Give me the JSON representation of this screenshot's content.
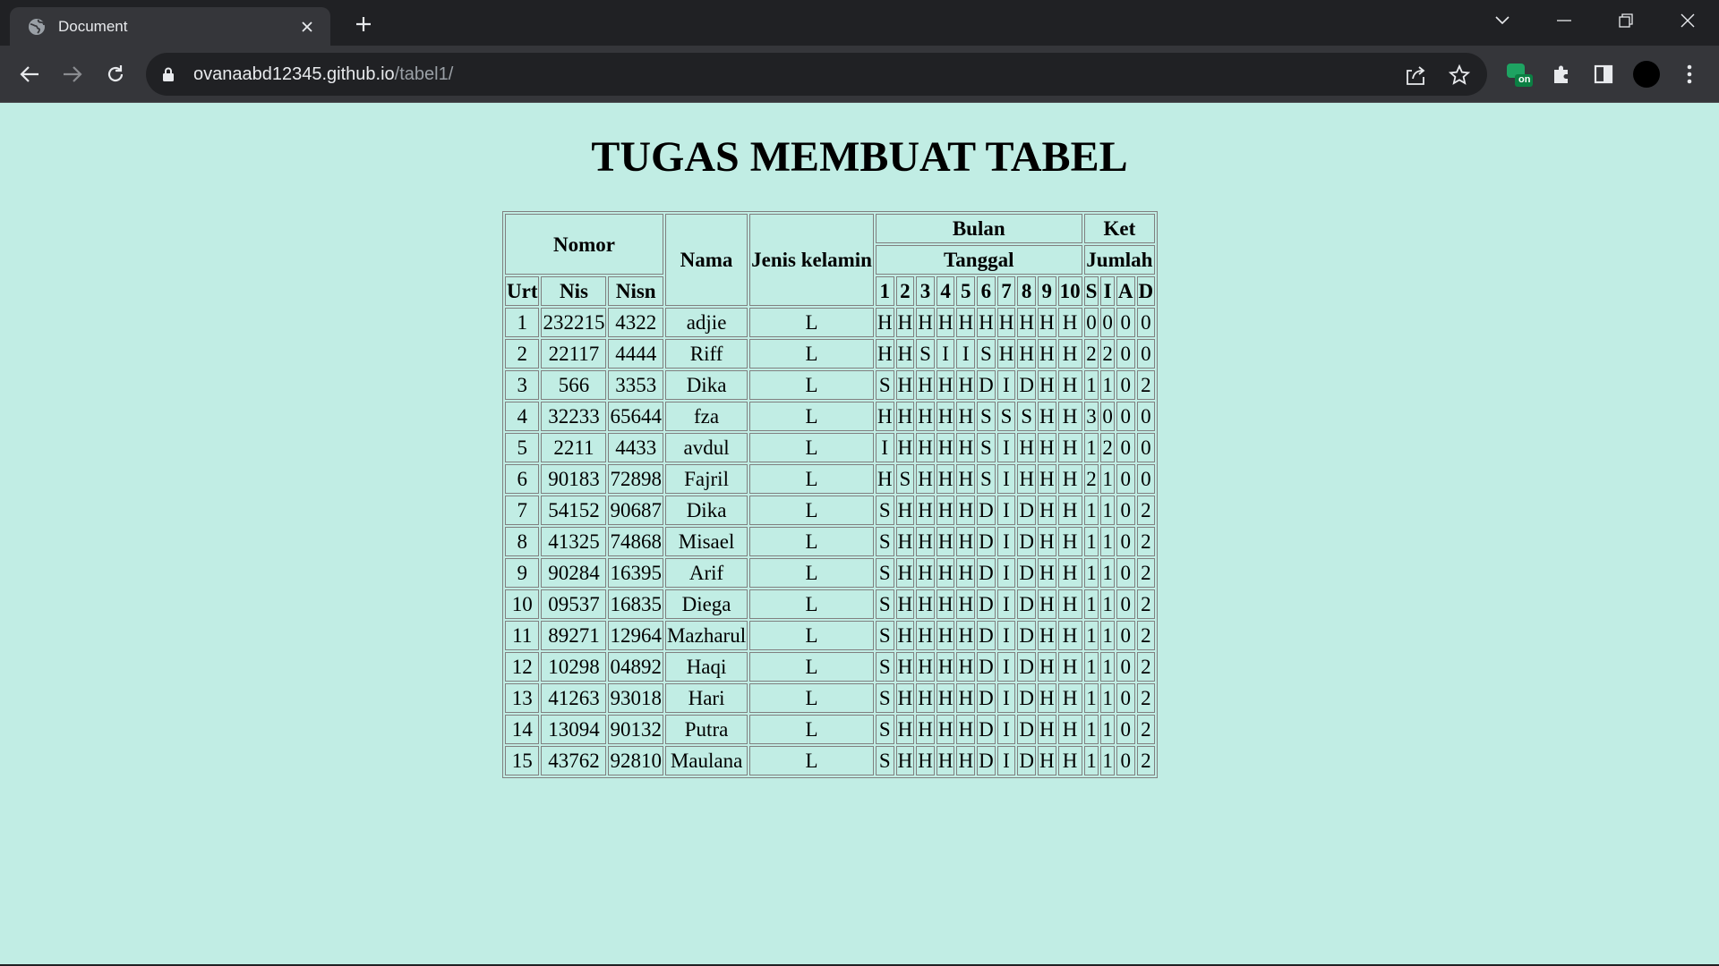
{
  "browser": {
    "tab_title": "Document",
    "url_host": "ovanaabd12345.github.io",
    "url_path": "/tabel1/",
    "extension_badge": "on"
  },
  "page": {
    "title": "TUGAS MEMBUAT TABEL"
  },
  "table": {
    "headers": {
      "nomor": "Nomor",
      "nama": "Nama",
      "jenis_kelamin": "Jenis kelamin",
      "bulan": "Bulan",
      "ket": "Ket",
      "tanggal": "Tanggal",
      "jumlah": "Jumlah",
      "urt": "Urt",
      "nis": "Nis",
      "nisn": "Nisn",
      "days": [
        "1",
        "2",
        "3",
        "4",
        "5",
        "6",
        "7",
        "8",
        "9",
        "10"
      ],
      "sums": [
        "S",
        "I",
        "A",
        "D"
      ]
    },
    "rows": [
      {
        "urt": "1",
        "nis": "232215",
        "nisn": "4322",
        "nama": "adjie",
        "jk": "L",
        "days": [
          "H",
          "H",
          "H",
          "H",
          "H",
          "H",
          "H",
          "H",
          "H",
          "H"
        ],
        "sums": [
          "0",
          "0",
          "0",
          "0"
        ]
      },
      {
        "urt": "2",
        "nis": "22117",
        "nisn": "4444",
        "nama": "Riff",
        "jk": "L",
        "days": [
          "H",
          "H",
          "S",
          "I",
          "I",
          "S",
          "H",
          "H",
          "H",
          "H"
        ],
        "sums": [
          "2",
          "2",
          "0",
          "0"
        ]
      },
      {
        "urt": "3",
        "nis": "566",
        "nisn": "3353",
        "nama": "Dika",
        "jk": "L",
        "days": [
          "S",
          "H",
          "H",
          "H",
          "H",
          "D",
          "I",
          "D",
          "H",
          "H"
        ],
        "sums": [
          "1",
          "1",
          "0",
          "2"
        ]
      },
      {
        "urt": "4",
        "nis": "32233",
        "nisn": "65644",
        "nama": "fza",
        "jk": "L",
        "days": [
          "H",
          "H",
          "H",
          "H",
          "H",
          "S",
          "S",
          "S",
          "H",
          "H"
        ],
        "sums": [
          "3",
          "0",
          "0",
          "0"
        ]
      },
      {
        "urt": "5",
        "nis": "2211",
        "nisn": "4433",
        "nama": "avdul",
        "jk": "L",
        "days": [
          "I",
          "H",
          "H",
          "H",
          "H",
          "S",
          "I",
          "H",
          "H",
          "H"
        ],
        "sums": [
          "1",
          "2",
          "0",
          "0"
        ]
      },
      {
        "urt": "6",
        "nis": "90183",
        "nisn": "72898",
        "nama": "Fajril",
        "jk": "L",
        "days": [
          "H",
          "S",
          "H",
          "H",
          "H",
          "S",
          "I",
          "H",
          "H",
          "H"
        ],
        "sums": [
          "2",
          "1",
          "0",
          "0"
        ]
      },
      {
        "urt": "7",
        "nis": "54152",
        "nisn": "90687",
        "nama": "Dika",
        "jk": "L",
        "days": [
          "S",
          "H",
          "H",
          "H",
          "H",
          "D",
          "I",
          "D",
          "H",
          "H"
        ],
        "sums": [
          "1",
          "1",
          "0",
          "2"
        ]
      },
      {
        "urt": "8",
        "nis": "41325",
        "nisn": "74868",
        "nama": "Misael",
        "jk": "L",
        "days": [
          "S",
          "H",
          "H",
          "H",
          "H",
          "D",
          "I",
          "D",
          "H",
          "H"
        ],
        "sums": [
          "1",
          "1",
          "0",
          "2"
        ]
      },
      {
        "urt": "9",
        "nis": "90284",
        "nisn": "16395",
        "nama": "Arif",
        "jk": "L",
        "days": [
          "S",
          "H",
          "H",
          "H",
          "H",
          "D",
          "I",
          "D",
          "H",
          "H"
        ],
        "sums": [
          "1",
          "1",
          "0",
          "2"
        ]
      },
      {
        "urt": "10",
        "nis": "09537",
        "nisn": "16835",
        "nama": "Diega",
        "jk": "L",
        "days": [
          "S",
          "H",
          "H",
          "H",
          "H",
          "D",
          "I",
          "D",
          "H",
          "H"
        ],
        "sums": [
          "1",
          "1",
          "0",
          "2"
        ]
      },
      {
        "urt": "11",
        "nis": "89271",
        "nisn": "12964",
        "nama": "Mazharul",
        "jk": "L",
        "days": [
          "S",
          "H",
          "H",
          "H",
          "H",
          "D",
          "I",
          "D",
          "H",
          "H"
        ],
        "sums": [
          "1",
          "1",
          "0",
          "2"
        ]
      },
      {
        "urt": "12",
        "nis": "10298",
        "nisn": "04892",
        "nama": "Haqi",
        "jk": "L",
        "days": [
          "S",
          "H",
          "H",
          "H",
          "H",
          "D",
          "I",
          "D",
          "H",
          "H"
        ],
        "sums": [
          "1",
          "1",
          "0",
          "2"
        ]
      },
      {
        "urt": "13",
        "nis": "41263",
        "nisn": "93018",
        "nama": "Hari",
        "jk": "L",
        "days": [
          "S",
          "H",
          "H",
          "H",
          "H",
          "D",
          "I",
          "D",
          "H",
          "H"
        ],
        "sums": [
          "1",
          "1",
          "0",
          "2"
        ]
      },
      {
        "urt": "14",
        "nis": "13094",
        "nisn": "90132",
        "nama": "Putra",
        "jk": "L",
        "days": [
          "S",
          "H",
          "H",
          "H",
          "H",
          "D",
          "I",
          "D",
          "H",
          "H"
        ],
        "sums": [
          "1",
          "1",
          "0",
          "2"
        ]
      },
      {
        "urt": "15",
        "nis": "43762",
        "nisn": "92810",
        "nama": "Maulana",
        "jk": "L",
        "days": [
          "S",
          "H",
          "H",
          "H",
          "H",
          "D",
          "I",
          "D",
          "H",
          "H"
        ],
        "sums": [
          "1",
          "1",
          "0",
          "2"
        ]
      }
    ]
  }
}
